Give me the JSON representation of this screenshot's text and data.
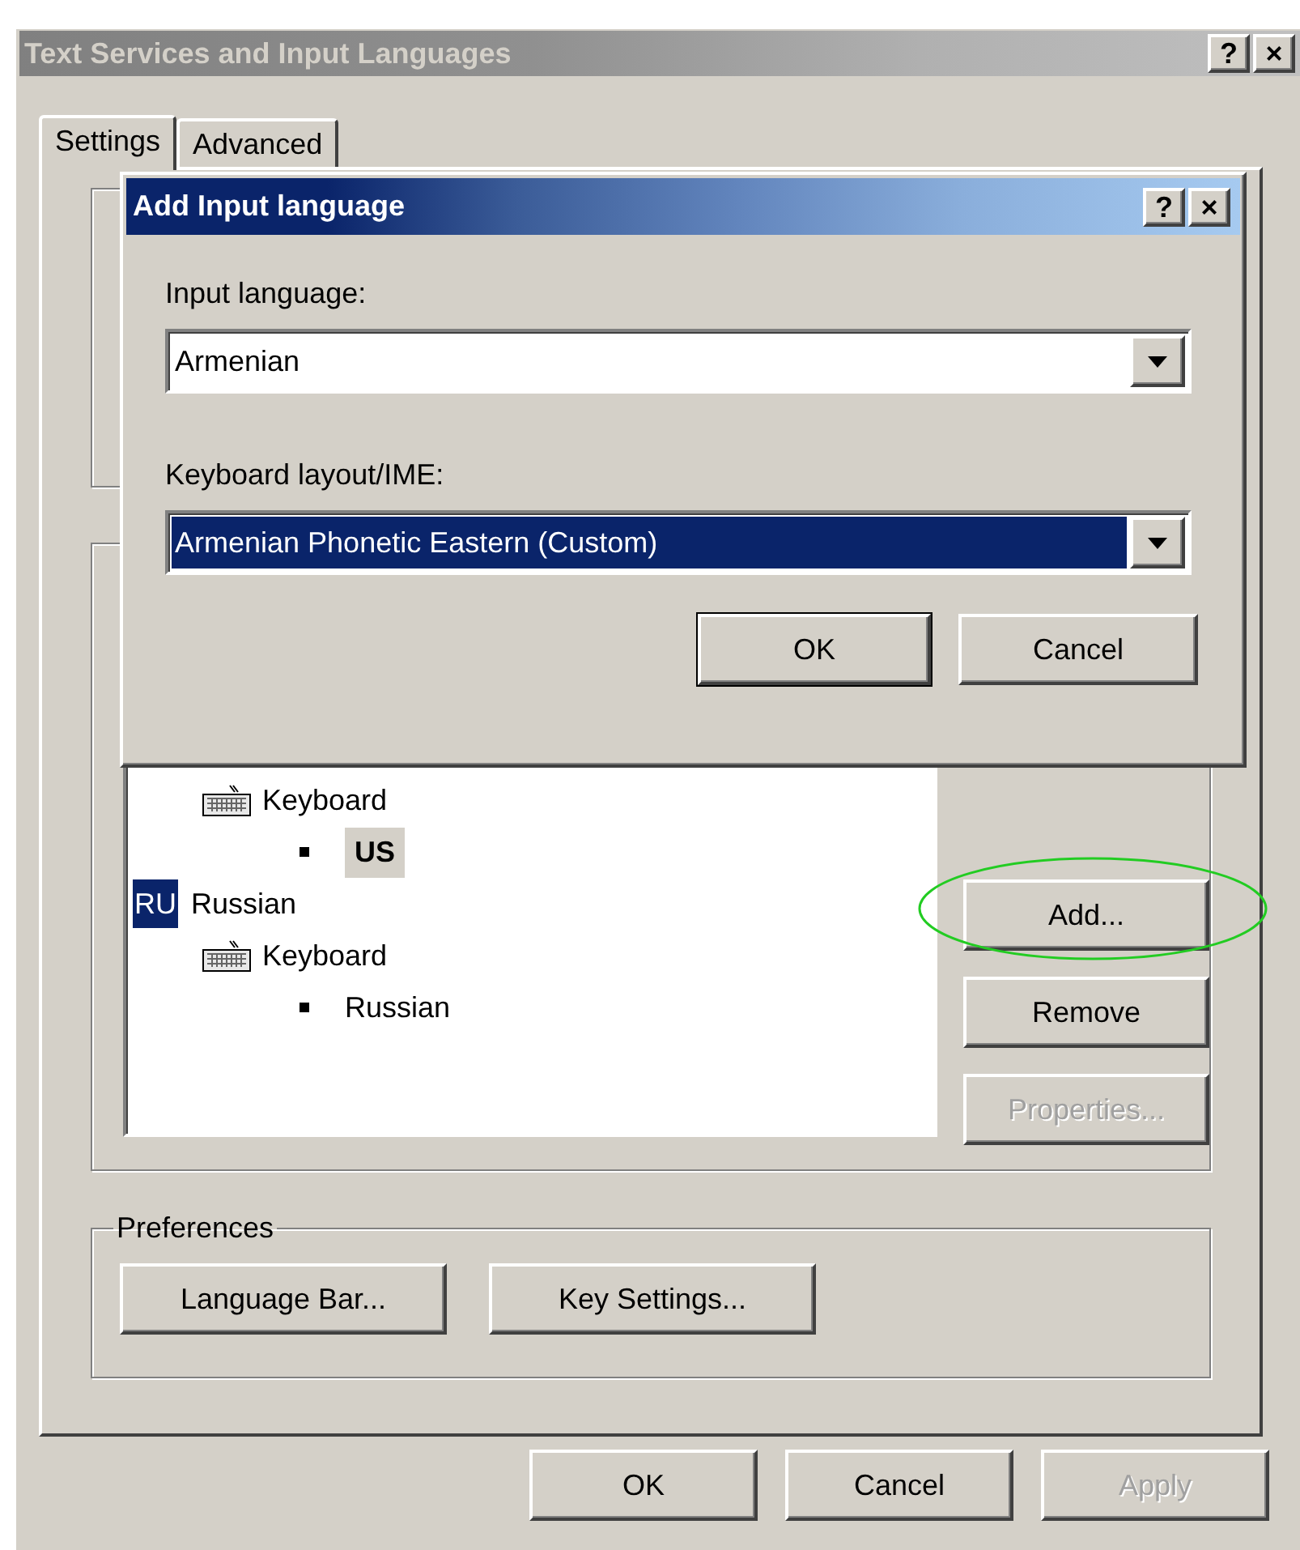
{
  "window": {
    "title": "Text Services and Input Languages",
    "title_buttons": [
      "?",
      "×"
    ]
  },
  "tabs": [
    {
      "label": "Settings",
      "selected": true
    },
    {
      "label": "Advanced",
      "selected": false
    }
  ],
  "installed_services": [
    {
      "children": [
        {
          "label": "Keyboard",
          "children": [
            {
              "label": "US",
              "selected": true
            }
          ]
        }
      ]
    },
    {
      "badge": "RU",
      "label": "Russian",
      "children": [
        {
          "label": "Keyboard",
          "children": [
            {
              "label": "Russian",
              "selected": false
            }
          ]
        }
      ]
    }
  ],
  "service_buttons": [
    {
      "label": "Add...",
      "disabled": false
    },
    {
      "label": "Remove",
      "disabled": false
    },
    {
      "label": "Properties...",
      "disabled": true
    }
  ],
  "preferences": {
    "title": "Preferences",
    "buttons": [
      "Language Bar...",
      "Key Settings..."
    ]
  },
  "buttons": [
    {
      "label": "OK",
      "disabled": false
    },
    {
      "label": "Cancel",
      "disabled": false
    },
    {
      "label": "Apply",
      "disabled": true
    }
  ],
  "dialog": {
    "title": "Add Input language",
    "title_buttons": [
      "?",
      "×"
    ],
    "fields": [
      {
        "label": "Input language:",
        "value": "Armenian",
        "selected": false
      },
      {
        "label": "Keyboard layout/IME:",
        "value": "Armenian Phonetic Eastern (Custom)",
        "selected": true
      }
    ],
    "buttons": [
      {
        "label": "OK",
        "default": true
      },
      {
        "label": "Cancel",
        "default": false
      }
    ]
  }
}
